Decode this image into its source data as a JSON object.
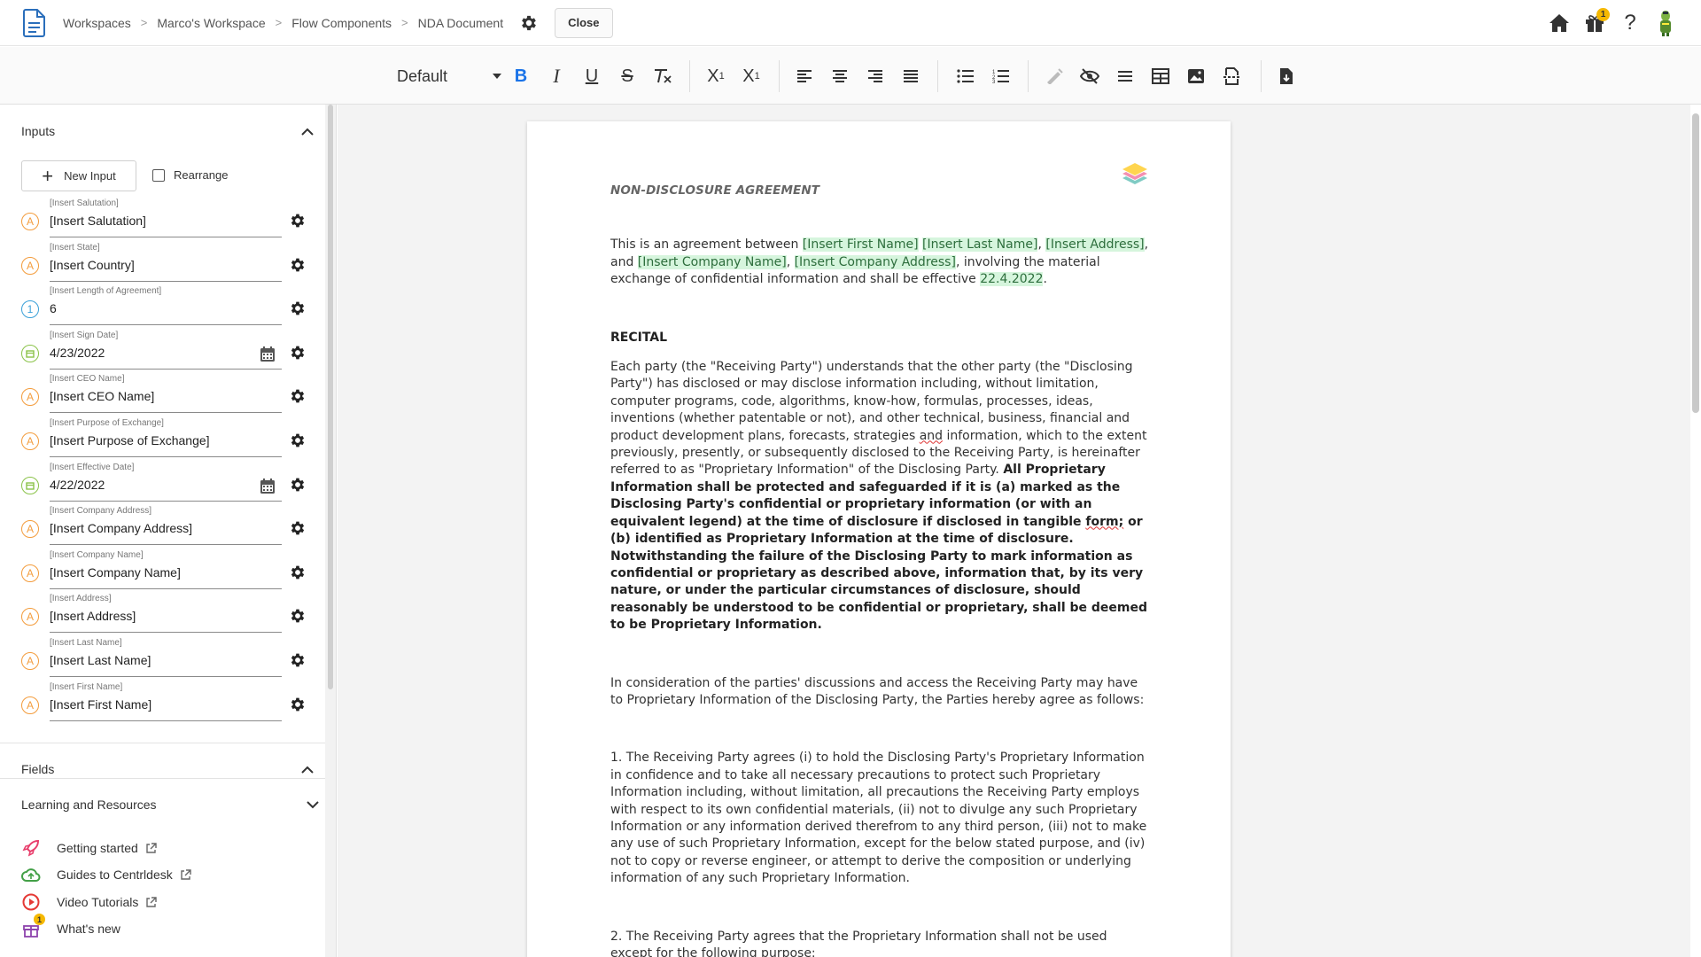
{
  "breadcrumb": [
    "Workspaces",
    "Marco's Workspace",
    "Flow Components",
    "NDA Document"
  ],
  "topbar": {
    "close_label": "Close",
    "gift_badge": "1"
  },
  "toolbar": {
    "style_value": "Default",
    "buttons": [
      "bold-icon",
      "italic-icon",
      "underline-icon",
      "strikethrough-icon",
      "clear-format-icon",
      "subscript-icon",
      "superscript-icon",
      "align-left-icon",
      "align-center-icon",
      "align-right-icon",
      "align-justify-icon",
      "bullet-list-icon",
      "numbered-list-icon",
      "highlight-icon",
      "hide-icon",
      "divider-icon",
      "table-icon",
      "image-icon",
      "page-break-icon",
      "export-icon"
    ],
    "accent": "#1a73e8"
  },
  "sidebar": {
    "inputs_title": "Inputs",
    "new_input_label": "New Input",
    "rearrange_label": "Rearrange",
    "inputs": [
      {
        "label": "[Insert Salutation]",
        "value": "[Insert Salutation]",
        "type": "text"
      },
      {
        "label": "[Insert State]",
        "value": "[Insert Country]",
        "type": "text"
      },
      {
        "label": "[Insert Length of Agreement]",
        "value": "6",
        "type": "number"
      },
      {
        "label": "[Insert Sign Date]",
        "value": "4/23/2022",
        "type": "date"
      },
      {
        "label": "[Insert CEO Name]",
        "value": "[Insert CEO Name]",
        "type": "text"
      },
      {
        "label": "[Insert Purpose of Exchange]",
        "value": "[Insert Purpose of Exchange]",
        "type": "text"
      },
      {
        "label": "[Insert Effective Date]",
        "value": "4/22/2022",
        "type": "date"
      },
      {
        "label": "[Insert Company Address]",
        "value": "[Insert Company Address]",
        "type": "text"
      },
      {
        "label": "[Insert Company Name]",
        "value": "[Insert Company Name]",
        "type": "text"
      },
      {
        "label": "[Insert Address]",
        "value": "[Insert Address]",
        "type": "text"
      },
      {
        "label": "[Insert Last Name]",
        "value": "[Insert Last Name]",
        "type": "text"
      },
      {
        "label": "[Insert First Name]",
        "value": "[Insert First Name]",
        "type": "text"
      }
    ],
    "type_icons": {
      "text": "A",
      "number": "1",
      "date": ""
    },
    "type_colors": {
      "text": "#f39c3c",
      "number": "#3aa0d8",
      "date": "#8bc34a"
    },
    "fields_title": "Fields",
    "resources_title": "Learning and Resources",
    "resources": [
      {
        "label": "Getting started",
        "icon": "rocket-icon",
        "external": true
      },
      {
        "label": "Guides to Centrldesk",
        "icon": "cloud-icon",
        "external": true
      },
      {
        "label": "Video Tutorials",
        "icon": "play-icon",
        "external": true
      },
      {
        "label": "What's new",
        "icon": "gift-icon",
        "external": false,
        "badge": "1"
      }
    ]
  },
  "document": {
    "title": "NON-DISCLOSURE AGREEMENT",
    "intro": {
      "t1": "This is an agreement between ",
      "h1": "[Insert First Name]",
      "t2": " ",
      "h2": "[Insert Last Name]",
      "t3": ", ",
      "h3": "[Insert Address]",
      "t4": ", and ",
      "h4": "[Insert Company Name]",
      "t5": ", ",
      "h5": "[Insert Company Address]",
      "t6": ", involving the material exchange of confidential information and shall be effective ",
      "h6": "22.4.2022",
      "t7": "."
    },
    "recital_heading": "RECITAL",
    "recital": {
      "p1": "Each party (the \"Receiving Party\") understands that the other party (the \"Disclosing Party\") has disclosed or may disclose information including, without limitation, computer programs, code, algorithms, know-how, formulas, processes, ideas, inventions (whether patentable or not), and other technical, business, financial and product development plans, forecasts, strategies ",
      "p1_sq": "and",
      "p1b": " information, which to the extent previously, presently, or subsequently disclosed to the Receiving Party, is hereinafter referred to as \"Proprietary Information\" of the Disclosing Party. ",
      "b1": "All Proprietary Information shall be protected and safeguarded if it is (a) marked as the Disclosing Party's confidential or proprietary information (or with an equivalent legend) at the time of disclosure if disclosed in tangible ",
      "b1_sq": "form;",
      "b2": " or (b) identified as Proprietary Information at the time of disclosure. Notwithstanding the failure of the Disclosing Party to mark information as confidential or proprietary as described above, information that, by its very nature, or under the particular circumstances of disclosure, should reasonably be understood to be confidential or proprietary, shall be deemed to be Proprietary Information."
    },
    "consideration": "In consideration of the parties' discussions and access the Receiving Party may have to Proprietary Information of the Disclosing Party, the Parties hereby agree as follows:",
    "clause1": "1. The Receiving Party agrees (i) to hold the Disclosing Party's Proprietary Information in confidence and to take all necessary precautions to protect such Proprietary Information including, without limitation, all precautions the Receiving Party employs with respect to its own confidential materials, (ii) not to divulge any such Proprietary Information or any information derived therefrom to any third person, (iii) not to make any use of such Proprietary Information, except for the below stated purpose, and (iv) not to copy or reverse engineer, or attempt to derive the composition or underlying information of any such Proprietary Information.",
    "clause2": "2. The Receiving Party agrees that the Proprietary Information shall not be used except for the following purpose:"
  }
}
